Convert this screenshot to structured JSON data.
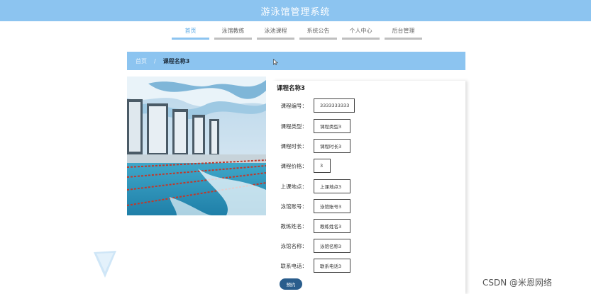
{
  "app": {
    "title": "游泳馆管理系统"
  },
  "nav": {
    "items": [
      {
        "label": "首页"
      },
      {
        "label": "泳馆教练"
      },
      {
        "label": "泳池课程"
      },
      {
        "label": "系统公告"
      },
      {
        "label": "个人中心"
      },
      {
        "label": "后台管理"
      }
    ],
    "active_index": 0
  },
  "breadcrumb": {
    "home": "首页",
    "separator": "/",
    "current": "课程名称3"
  },
  "course": {
    "title": "课程名称3",
    "fields": [
      {
        "label": "课程编号：",
        "value": "3333333333"
      },
      {
        "label": "课程类型：",
        "value": "课程类型3"
      },
      {
        "label": "课程时长：",
        "value": "课程时长3"
      },
      {
        "label": "课程价格：",
        "value": "3"
      },
      {
        "label": "上课地点：",
        "value": "上课地点3"
      },
      {
        "label": "泳馆账号：",
        "value": "泳馆账号3"
      },
      {
        "label": "教练姓名：",
        "value": "教练姓名3"
      },
      {
        "label": "泳馆名称：",
        "value": "泳馆名称3"
      },
      {
        "label": "联系电话：",
        "value": "联系电话3"
      }
    ],
    "book_label": "预约"
  },
  "watermark": "CSDN @米恩网络",
  "colors": {
    "accent": "#8cc4f0",
    "button": "#2a5d8c"
  }
}
